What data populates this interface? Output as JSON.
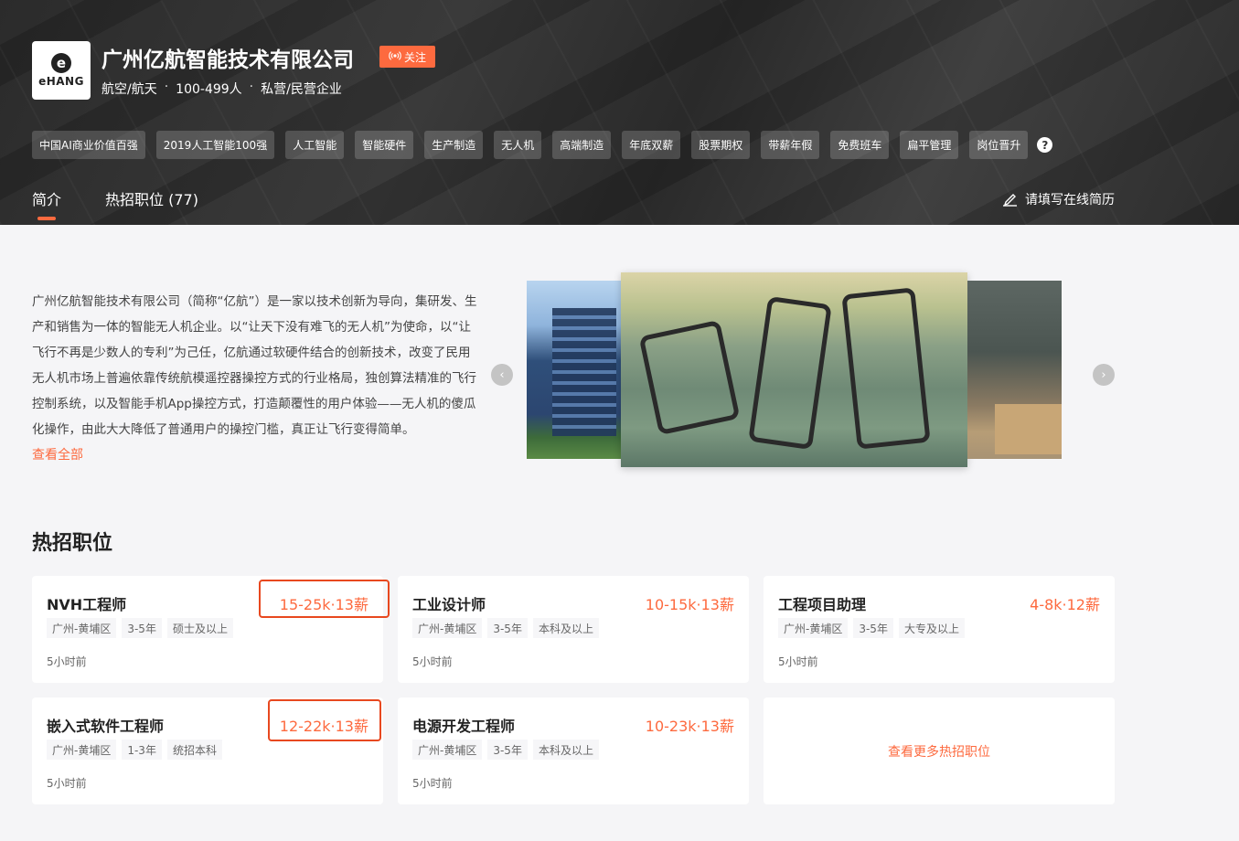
{
  "company": {
    "name": "广州亿航智能技术有限公司",
    "logo_text": "eHANG",
    "logo_mark": "e",
    "follow_label": "关注",
    "meta": [
      "航空/航天",
      "100-499人",
      "私营/民营企业"
    ],
    "meta_sep": "·"
  },
  "tags": [
    "中国AI商业价值百强",
    "2019人工智能100强",
    "人工智能",
    "智能硬件",
    "生产制造",
    "无人机",
    "高端制造",
    "年底双薪",
    "股票期权",
    "带薪年假",
    "免费班车",
    "扁平管理",
    "岗位晋升"
  ],
  "help_glyph": "?",
  "tabs": [
    {
      "label": "简介",
      "active": true
    },
    {
      "label": "热招职位 (77)",
      "active": false
    }
  ],
  "resume_link": "请填写在线简历",
  "intro": {
    "text": "广州亿航智能技术有限公司（简称“亿航”）是一家以技术创新为导向，集研发、生产和销售为一体的智能无人机企业。以“让天下没有难飞的无人机”为使命，以“让飞行不再是少数人的专利”为己任，亿航通过软硬件结合的创新技术，改变了民用无人机市场上普遍依靠传统航模遥控器操控方式的行业格局，独创算法精准的飞行控制系统，以及智能手机App操控方式，打造颠覆性的用户体验——无人机的傻瓜化操作，由此大大降低了普通用户的操控门槛，真正让飞行变得简单。",
    "view_all": "查看全部"
  },
  "carousel": {
    "prev_glyph": "‹",
    "next_glyph": "›"
  },
  "hot_jobs": {
    "title": "热招职位",
    "jobs": [
      {
        "title": "NVH工程师",
        "salary": "15-25k·13薪",
        "reqs": [
          "广州-黄埔区",
          "3-5年",
          "硕士及以上"
        ],
        "time": "5小时前"
      },
      {
        "title": "工业设计师",
        "salary": "10-15k·13薪",
        "reqs": [
          "广州-黄埔区",
          "3-5年",
          "本科及以上"
        ],
        "time": "5小时前"
      },
      {
        "title": "工程项目助理",
        "salary": "4-8k·12薪",
        "reqs": [
          "广州-黄埔区",
          "3-5年",
          "大专及以上"
        ],
        "time": "5小时前"
      },
      {
        "title": "嵌入式软件工程师",
        "salary": "12-22k·13薪",
        "reqs": [
          "广州-黄埔区",
          "1-3年",
          "统招本科"
        ],
        "time": "5小时前"
      },
      {
        "title": "电源开发工程师",
        "salary": "10-23k·13薪",
        "reqs": [
          "广州-黄埔区",
          "3-5年",
          "本科及以上"
        ],
        "time": "5小时前"
      }
    ],
    "more_label": "查看更多热招职位"
  },
  "colors": {
    "accent": "#fd6a3f",
    "highlight_box": "#e8481f"
  }
}
